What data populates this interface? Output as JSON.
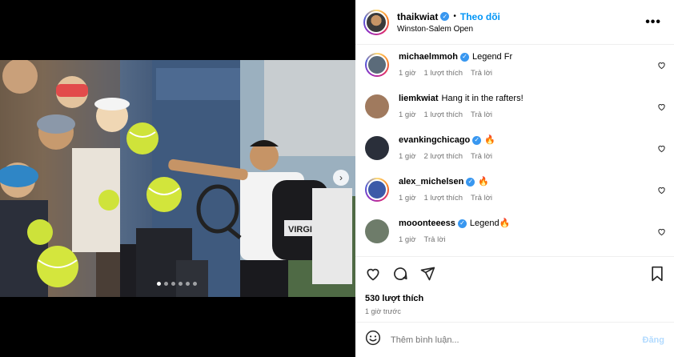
{
  "post": {
    "author": "thaikwiat",
    "follow_label": "Theo dõi",
    "separator": "•",
    "location": "Winston-Salem Open",
    "more_label": "•••"
  },
  "media": {
    "next_icon": "chevron-right-icon",
    "slide_count": 6,
    "active_slide": 1,
    "racket_text": "VIRGINIA"
  },
  "comments": [
    {
      "user": "michaelmmoh",
      "verified": true,
      "text": "Legend Fr",
      "time": "1 giờ",
      "likes": "1 lượt thích",
      "reply": "Trả lời",
      "avatar_color": "#5b6b7a"
    },
    {
      "user": "liemkwiat",
      "verified": false,
      "text": "Hang it in the rafters!",
      "time": "1 giờ",
      "likes": "1 lượt thích",
      "reply": "Trả lời",
      "avatar_color": "#a07a5e"
    },
    {
      "user": "evankingchicago",
      "verified": true,
      "text": "🔥",
      "time": "1 giờ",
      "likes": "2 lượt thích",
      "reply": "Trả lời",
      "avatar_color": "#2a2f3a"
    },
    {
      "user": "alex_michelsen",
      "verified": true,
      "text": "🔥",
      "time": "1 giờ",
      "likes": "1 lượt thích",
      "reply": "Trả lời",
      "avatar_color": "#3c5aa8"
    },
    {
      "user": "mooonteeess",
      "verified": true,
      "text": "Legend🔥",
      "time": "1 giờ",
      "likes": "",
      "reply": "Trả lời",
      "avatar_color": "#6e7c6a"
    }
  ],
  "actions": {
    "like_icon": "heart-icon",
    "comment_icon": "comment-icon",
    "share_icon": "send-icon",
    "save_icon": "bookmark-icon"
  },
  "likes_count": "530 lượt thích",
  "posted_time": "1 giờ trước",
  "add_comment": {
    "placeholder": "Thêm bình luận...",
    "post_label": "Đăng",
    "emoji_icon": "emoji-icon"
  },
  "colors": {
    "accent": "#0095f6",
    "verified": "#3897f0",
    "muted": "#737373"
  }
}
